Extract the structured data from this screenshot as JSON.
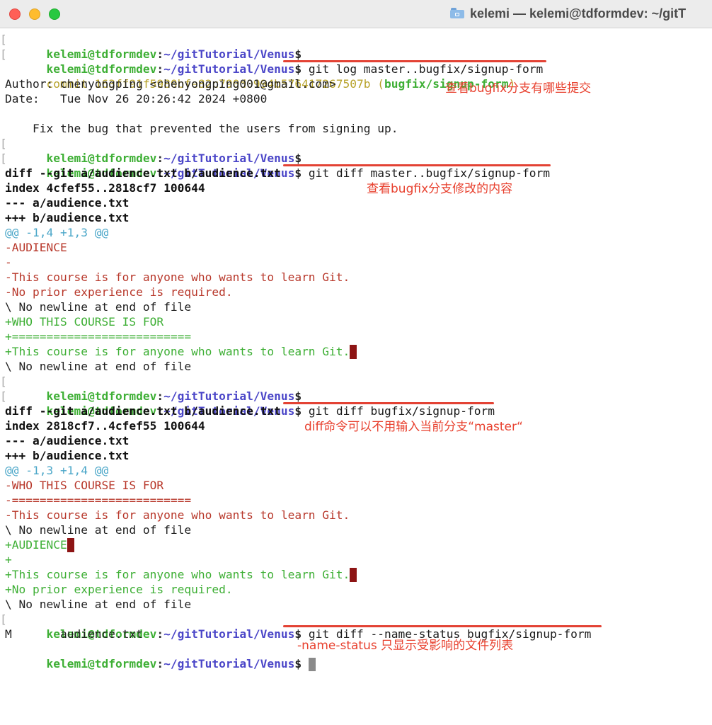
{
  "window": {
    "title": "kelemi — kelemi@tdformdev: ~/gitT",
    "title_icon": "folder-icon",
    "traffic_lights": [
      "close-button",
      "minimize-button",
      "zoom-button"
    ]
  },
  "prompt": {
    "user_host": "kelemi@tdformdev",
    "colon": ":",
    "path": "~/gitTutorial/Venus",
    "dollar": "$"
  },
  "terminal": {
    "cmd1": " git log master..bugfix/signup-form",
    "commit_prefix": "commit 163ff91f5980bfe82c790d0994b576417267507b (",
    "commit_branch": "bugfix/signup-form",
    "commit_suffix": ")",
    "author": "Author: chenyongping <chenyongping001@gmail.com>",
    "date": "Date:   Tue Nov 26 20:26:42 2024 +0800",
    "message": "    Fix the bug that prevented the users from signing up.",
    "cmd2": " git diff master..bugfix/signup-form",
    "diff1": {
      "header": "diff --git a/audience.txt b/audience.txt",
      "index": "index 4cfef55..2818cf7 100644",
      "minus_file": "--- a/audience.txt",
      "plus_file": "+++ b/audience.txt",
      "hunk": "@@ -1,4 +1,3 @@",
      "l1": "-AUDIENCE",
      "l2": "-",
      "l3": "-This course is for anyone who wants to learn Git.",
      "l4": "-No prior experience is required.",
      "l5": "\\ No newline at end of file",
      "l6": "+WHO THIS COURSE IS FOR",
      "l7": "+==========================",
      "l8": "+This course is for anyone who wants to learn Git.",
      "l9": "\\ No newline at end of file"
    },
    "cmd3": " git diff bugfix/signup-form",
    "diff2": {
      "header": "diff --git a/audience.txt b/audience.txt",
      "index": "index 2818cf7..4cfef55 100644",
      "minus_file": "--- a/audience.txt",
      "plus_file": "+++ b/audience.txt",
      "hunk": "@@ -1,3 +1,4 @@",
      "l1": "-WHO THIS COURSE IS FOR",
      "l2": "-==========================",
      "l3": "-This course is for anyone who wants to learn Git.",
      "l4": "\\ No newline at end of file",
      "l5": "+AUDIENCE",
      "l6": "+",
      "l7": "+This course is for anyone who wants to learn Git.",
      "l8": "+No prior experience is required.",
      "l9": "\\ No newline at end of file"
    },
    "cmd4": " git diff --name-status bugfix/signup-form",
    "status_line": "M       audience.txt"
  },
  "annotations": {
    "a1": "查看bugfix分支有哪些提交",
    "a2": "查看bugfix分支修改的内容",
    "a3": "diff命令可以不用输入当前分支“master“",
    "a4": "-name-status 只显示受影响的文件列表"
  },
  "colors": {
    "prompt_user": "#3eaf35",
    "prompt_path": "#4b46c8",
    "diff_removed": "#b8382b",
    "diff_added": "#3eaf35",
    "diff_hunk": "#4aa6c8",
    "commit_hash": "#b7a229",
    "annotation": "#e8412f",
    "cursor": "#8d1414"
  }
}
